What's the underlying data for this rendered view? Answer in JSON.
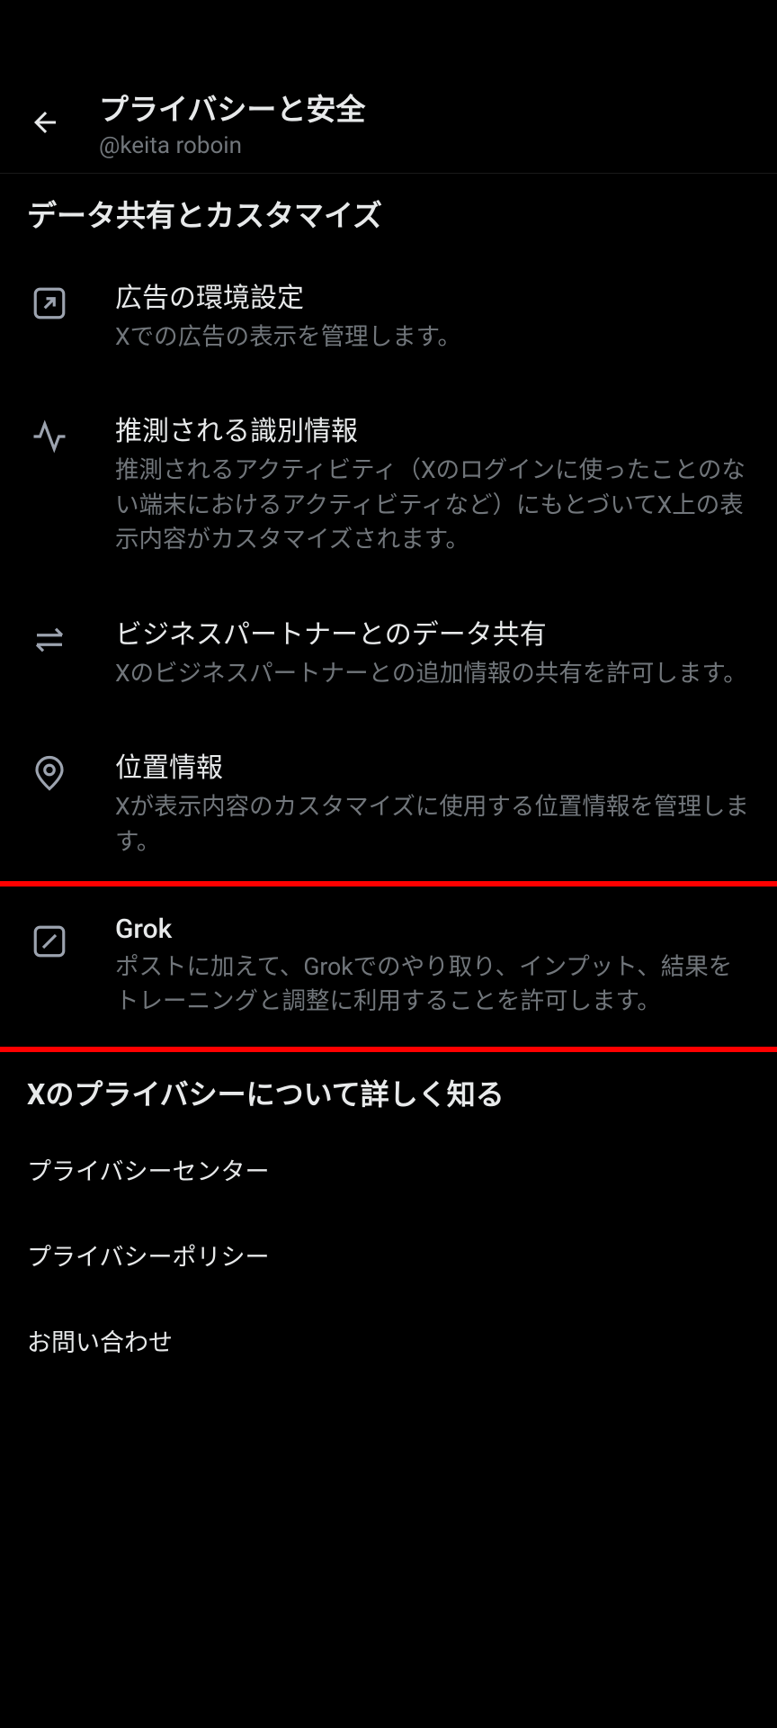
{
  "header": {
    "title": "プライバシーと安全",
    "username": "@keita roboin"
  },
  "sections": {
    "data_sharing": {
      "heading": "データ共有とカスタマイズ",
      "items": {
        "ad_preferences": {
          "title": "広告の環境設定",
          "description": "Xでの広告の表示を管理します。"
        },
        "inferred_identity": {
          "title": "推測される識別情報",
          "description": "推測されるアクティビティ（Xのログインに使ったことのない端末におけるアクティビティなど）にもとづいてX上の表示内容がカスタマイズされます。"
        },
        "business_partner": {
          "title": "ビジネスパートナーとのデータ共有",
          "description": "Xのビジネスパートナーとの追加情報の共有を許可します。"
        },
        "location": {
          "title": "位置情報",
          "description": "Xが表示内容のカスタマイズに使用する位置情報を管理します。"
        },
        "grok": {
          "title": "Grok",
          "description": "ポストに加えて、Grokでのやり取り、インプット、結果をトレーニングと調整に利用することを許可します。"
        }
      }
    },
    "learn_more": {
      "heading": "Xのプライバシーについて詳しく知る",
      "links": {
        "privacy_center": "プライバシーセンター",
        "privacy_policy": "プライバシーポリシー",
        "contact": "お問い合わせ"
      }
    }
  }
}
